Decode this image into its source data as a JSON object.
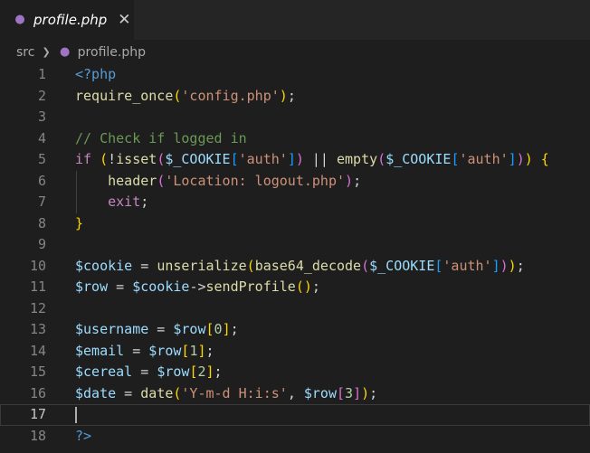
{
  "tab": {
    "icon": "php-elephant-icon",
    "label": "profile.php",
    "close_glyph": "✕"
  },
  "breadcrumb": {
    "folder": "src",
    "file": "profile.php"
  },
  "editor": {
    "current_line": 17,
    "lines": [
      {
        "num": "1",
        "tokens": [
          [
            "t-kw",
            "<?php"
          ]
        ]
      },
      {
        "num": "2",
        "tokens": [
          [
            "t-fn",
            "require_once"
          ],
          [
            "t-p1",
            "("
          ],
          [
            "t-str",
            "'config.php'"
          ],
          [
            "t-p1",
            ")"
          ],
          [
            "t-plain",
            ";"
          ]
        ]
      },
      {
        "num": "3",
        "tokens": []
      },
      {
        "num": "4",
        "tokens": [
          [
            "t-com",
            "// Check if logged in"
          ]
        ]
      },
      {
        "num": "5",
        "tokens": [
          [
            "t-ctl",
            "if"
          ],
          [
            "t-plain",
            " "
          ],
          [
            "t-p1",
            "("
          ],
          [
            "t-plain",
            "!"
          ],
          [
            "t-fn",
            "isset"
          ],
          [
            "t-p2",
            "("
          ],
          [
            "t-var",
            "$_COOKIE"
          ],
          [
            "t-p3",
            "["
          ],
          [
            "t-str",
            "'auth'"
          ],
          [
            "t-p3",
            "]"
          ],
          [
            "t-p2",
            ")"
          ],
          [
            "t-plain",
            " || "
          ],
          [
            "t-fn",
            "empty"
          ],
          [
            "t-p2",
            "("
          ],
          [
            "t-var",
            "$_COOKIE"
          ],
          [
            "t-p3",
            "["
          ],
          [
            "t-str",
            "'auth'"
          ],
          [
            "t-p3",
            "]"
          ],
          [
            "t-p2",
            ")"
          ],
          [
            "t-p1",
            ")"
          ],
          [
            "t-plain",
            " "
          ],
          [
            "t-p1",
            "{"
          ]
        ]
      },
      {
        "num": "6",
        "tokens": [
          [
            "t-plain",
            "    "
          ],
          [
            "t-fn",
            "header"
          ],
          [
            "t-p2",
            "("
          ],
          [
            "t-str",
            "'Location: logout.php'"
          ],
          [
            "t-p2",
            ")"
          ],
          [
            "t-plain",
            ";"
          ]
        ]
      },
      {
        "num": "7",
        "tokens": [
          [
            "t-plain",
            "    "
          ],
          [
            "t-ctl",
            "exit"
          ],
          [
            "t-plain",
            ";"
          ]
        ]
      },
      {
        "num": "8",
        "tokens": [
          [
            "t-p1",
            "}"
          ]
        ]
      },
      {
        "num": "9",
        "tokens": []
      },
      {
        "num": "10",
        "tokens": [
          [
            "t-var",
            "$cookie"
          ],
          [
            "t-plain",
            " = "
          ],
          [
            "t-fn",
            "unserialize"
          ],
          [
            "t-p1",
            "("
          ],
          [
            "t-fn",
            "base64_decode"
          ],
          [
            "t-p2",
            "("
          ],
          [
            "t-var",
            "$_COOKIE"
          ],
          [
            "t-p3",
            "["
          ],
          [
            "t-str",
            "'auth'"
          ],
          [
            "t-p3",
            "]"
          ],
          [
            "t-p2",
            ")"
          ],
          [
            "t-p1",
            ")"
          ],
          [
            "t-plain",
            ";"
          ]
        ]
      },
      {
        "num": "11",
        "tokens": [
          [
            "t-var",
            "$row"
          ],
          [
            "t-plain",
            " = "
          ],
          [
            "t-var",
            "$cookie"
          ],
          [
            "t-plain",
            "->"
          ],
          [
            "t-fn",
            "sendProfile"
          ],
          [
            "t-p1",
            "()"
          ],
          [
            "t-plain",
            ";"
          ]
        ]
      },
      {
        "num": "12",
        "tokens": []
      },
      {
        "num": "13",
        "tokens": [
          [
            "t-var",
            "$username"
          ],
          [
            "t-plain",
            " = "
          ],
          [
            "t-var",
            "$row"
          ],
          [
            "t-p1",
            "["
          ],
          [
            "t-num",
            "0"
          ],
          [
            "t-p1",
            "]"
          ],
          [
            "t-plain",
            ";"
          ]
        ]
      },
      {
        "num": "14",
        "tokens": [
          [
            "t-var",
            "$email"
          ],
          [
            "t-plain",
            " = "
          ],
          [
            "t-var",
            "$row"
          ],
          [
            "t-p1",
            "["
          ],
          [
            "t-num",
            "1"
          ],
          [
            "t-p1",
            "]"
          ],
          [
            "t-plain",
            ";"
          ]
        ]
      },
      {
        "num": "15",
        "tokens": [
          [
            "t-var",
            "$cereal"
          ],
          [
            "t-plain",
            " = "
          ],
          [
            "t-var",
            "$row"
          ],
          [
            "t-p1",
            "["
          ],
          [
            "t-num",
            "2"
          ],
          [
            "t-p1",
            "]"
          ],
          [
            "t-plain",
            ";"
          ]
        ]
      },
      {
        "num": "16",
        "tokens": [
          [
            "t-var",
            "$date"
          ],
          [
            "t-plain",
            " = "
          ],
          [
            "t-fn",
            "date"
          ],
          [
            "t-p1",
            "("
          ],
          [
            "t-str",
            "'Y-m-d H:i:s'"
          ],
          [
            "t-plain",
            ", "
          ],
          [
            "t-var",
            "$row"
          ],
          [
            "t-p2",
            "["
          ],
          [
            "t-num",
            "3"
          ],
          [
            "t-p2",
            "]"
          ],
          [
            "t-p1",
            ")"
          ],
          [
            "t-plain",
            ";"
          ]
        ]
      },
      {
        "num": "17",
        "tokens": []
      },
      {
        "num": "18",
        "tokens": [
          [
            "t-kw",
            "?>"
          ]
        ]
      }
    ]
  }
}
